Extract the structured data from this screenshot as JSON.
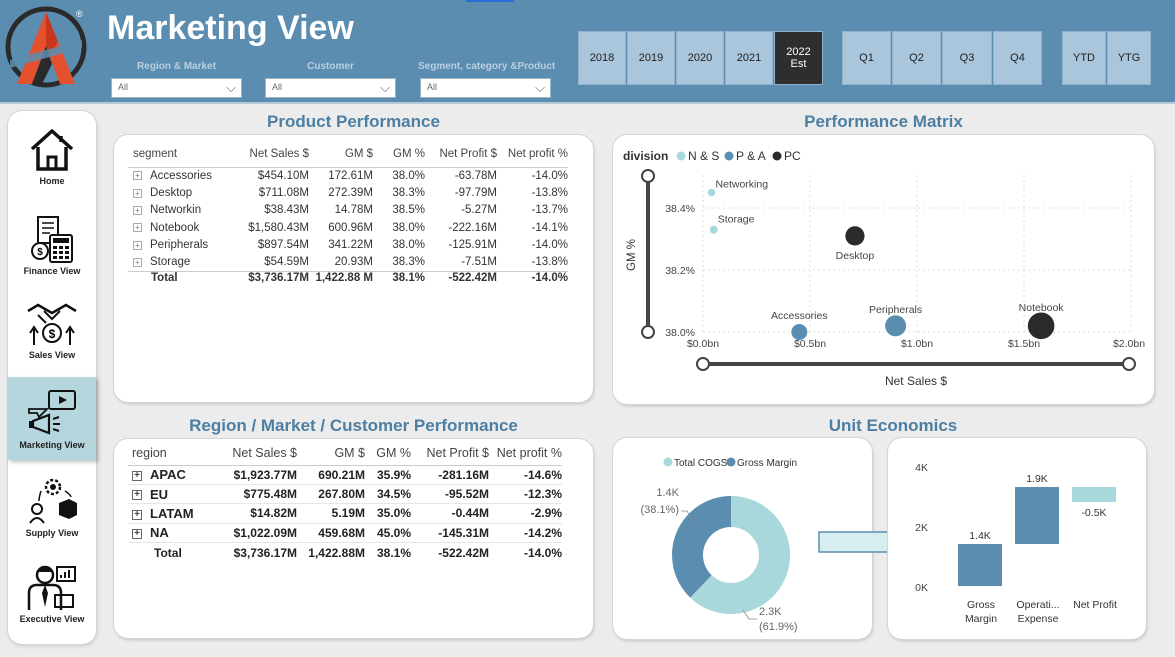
{
  "header": {
    "title": "Marketing View",
    "registered": "®",
    "filters": [
      {
        "label": "Region & Market",
        "value": "All"
      },
      {
        "label": "Customer",
        "value": "All"
      },
      {
        "label": "Segment, category &Product",
        "value": "All"
      }
    ],
    "years": [
      {
        "label": "2018"
      },
      {
        "label": "2019"
      },
      {
        "label": "2020"
      },
      {
        "label": "2021"
      },
      {
        "label": "2022",
        "sub": "Est",
        "selected": true
      }
    ],
    "quarters": [
      "Q1",
      "Q2",
      "Q3",
      "Q4"
    ],
    "periods": [
      "YTD",
      "YTG"
    ]
  },
  "sidebar": {
    "items": [
      {
        "label": "Home",
        "icon": "home-icon"
      },
      {
        "label": "Finance View",
        "icon": "calculator-icon"
      },
      {
        "label": "Sales View",
        "icon": "handshake-icon"
      },
      {
        "label": "Marketing View",
        "icon": "megaphone-icon",
        "active": true
      },
      {
        "label": "Supply View",
        "icon": "supply-chain-icon"
      },
      {
        "label": "Executive View",
        "icon": "executive-icon"
      }
    ]
  },
  "product_performance": {
    "title": "Product Performance",
    "columns": [
      "segment",
      "Net Sales $",
      "GM $",
      "GM %",
      "Net Profit $",
      "Net profit %"
    ],
    "rows": [
      [
        "Accessories",
        "$454.10M",
        "172.61M",
        "38.0%",
        "-63.78M",
        "-14.0%"
      ],
      [
        "Desktop",
        "$711.08M",
        "272.39M",
        "38.3%",
        "-97.79M",
        "-13.8%"
      ],
      [
        "Networkin",
        "$38.43M",
        "14.78M",
        "38.5%",
        "-5.27M",
        "-13.7%"
      ],
      [
        "Notebook",
        "$1,580.43M",
        "600.96M",
        "38.0%",
        "-222.16M",
        "-14.1%"
      ],
      [
        "Peripherals",
        "$897.54M",
        "341.22M",
        "38.0%",
        "-125.91M",
        "-14.0%"
      ],
      [
        "Storage",
        "$54.59M",
        "20.93M",
        "38.3%",
        "-7.51M",
        "-13.8%"
      ]
    ],
    "total": [
      "Total",
      "$3,736.17M",
      "1,422.88 M",
      "38.1%",
      "-522.42M",
      "-14.0%"
    ]
  },
  "performance_matrix": {
    "title": "Performance Matrix",
    "legend_title": "division",
    "legend": [
      {
        "name": "N & S",
        "color": "#a8d8db"
      },
      {
        "name": "P & A",
        "color": "#5b8db0"
      },
      {
        "name": "PC",
        "color": "#2b2b2b"
      }
    ],
    "ylabel": "GM %",
    "xlabel": "Net Sales $",
    "yticks": [
      "38.4%",
      "38.2%",
      "38.0%"
    ],
    "xticks": [
      "$0.0bn",
      "$0.5bn",
      "$1.0bn",
      "$1.5bn",
      "$2.0bn"
    ]
  },
  "chart_data": [
    {
      "type": "scatter",
      "title": "Performance Matrix",
      "xlabel": "Net Sales $",
      "ylabel": "GM %",
      "xlim": [
        0,
        2.0
      ],
      "ylim": [
        37.98,
        38.5
      ],
      "series": [
        {
          "name": "N & S",
          "color": "#a8d8db",
          "points": [
            {
              "label": "Networking",
              "x": 0.04,
              "y": 38.45,
              "size": 0.04
            },
            {
              "label": "Storage",
              "x": 0.05,
              "y": 38.33,
              "size": 0.05
            }
          ]
        },
        {
          "name": "P & A",
          "color": "#5b8db0",
          "points": [
            {
              "label": "Accessories",
              "x": 0.45,
              "y": 38.0,
              "size": 0.45
            },
            {
              "label": "Peripherals",
              "x": 0.9,
              "y": 38.02,
              "size": 0.9
            }
          ]
        },
        {
          "name": "PC",
          "color": "#2b2b2b",
          "points": [
            {
              "label": "Desktop",
              "x": 0.71,
              "y": 38.31,
              "size": 0.71
            },
            {
              "label": "Notebook",
              "x": 1.58,
              "y": 38.02,
              "size": 1.58
            }
          ]
        }
      ]
    },
    {
      "type": "pie",
      "title": "",
      "legend": [
        "Total COGS",
        "Gross Margin"
      ],
      "slices": [
        {
          "name": "Total COGS",
          "value": 2.3,
          "label": "2.3K",
          "pct": "(61.9%)",
          "color": "#a8d8db"
        },
        {
          "name": "Gross Margin",
          "value": 1.4,
          "label": "1.4K",
          "pct": "(38.1%)",
          "color": "#5b8db0"
        }
      ]
    },
    {
      "type": "bar",
      "title": "",
      "categories": [
        "Gross Margin",
        "Operati... Expense",
        "Net Profit"
      ],
      "values": [
        1.4,
        1.9,
        -0.5
      ],
      "value_labels": [
        "1.4K",
        "1.9K",
        "-0.5K"
      ],
      "ylim": [
        0,
        4
      ],
      "yticks": [
        "4K",
        "2K",
        "0K"
      ]
    }
  ],
  "region_performance": {
    "title": "Region / Market / Customer Performance",
    "columns": [
      "region",
      "Net Sales $",
      "GM $",
      "GM %",
      "Net Profit $",
      "Net profit %"
    ],
    "rows": [
      [
        "APAC",
        "$1,923.77M",
        "690.21M",
        "35.9%",
        "-281.16M",
        "-14.6%"
      ],
      [
        "EU",
        "$775.48M",
        "267.80M",
        "34.5%",
        "-95.52M",
        "-12.3%"
      ],
      [
        "LATAM",
        "$14.82M",
        "5.19M",
        "35.0%",
        "-0.44M",
        "-2.9%"
      ],
      [
        "NA",
        "$1,022.09M",
        "459.68M",
        "45.0%",
        "-145.31M",
        "-14.2%"
      ]
    ],
    "total": [
      "Total",
      "$3,736.17M",
      "1,422.88M",
      "38.1%",
      "-522.42M",
      "-14.0%"
    ]
  },
  "unit_economics": {
    "title": "Unit Economics",
    "donut": {
      "legend": [
        {
          "name": "Total COGS",
          "color": "#a8d8db"
        },
        {
          "name": "Gross Margin",
          "color": "#5b8db0"
        }
      ],
      "slices": [
        {
          "value": "2.3K",
          "pct": "(61.9%)"
        },
        {
          "value": "1.4K",
          "pct": "(38.1%)"
        }
      ]
    },
    "waterfall": {
      "yticks": [
        "4K",
        "2K",
        "0K"
      ],
      "labels": [
        "Gross Margin",
        "Operati... Expense",
        "Net Profit"
      ],
      "values": [
        "1.4K",
        "1.9K",
        "-0.5K"
      ]
    }
  }
}
